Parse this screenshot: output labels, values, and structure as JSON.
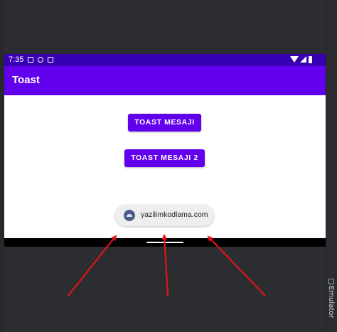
{
  "status_bar": {
    "time": "7:35",
    "icons": [
      "notification-icon",
      "sim-icon",
      "sd-card-icon",
      "wifi-icon",
      "signal-icon",
      "battery-icon"
    ]
  },
  "app_bar": {
    "title": "Toast"
  },
  "buttons": {
    "toast_message_1": "TOAST MESAJI",
    "toast_message_2": "TOAST MESAJI 2"
  },
  "toast": {
    "icon": "android-icon",
    "text": "yazilimkodlama.com"
  },
  "side_panel": {
    "emulator_tab": "Emulator"
  },
  "colors": {
    "primary": "#6200ee",
    "primary_dark": "#3700b3",
    "annotation_arrow": "#e0141b",
    "ide_background": "#2b2d30"
  }
}
